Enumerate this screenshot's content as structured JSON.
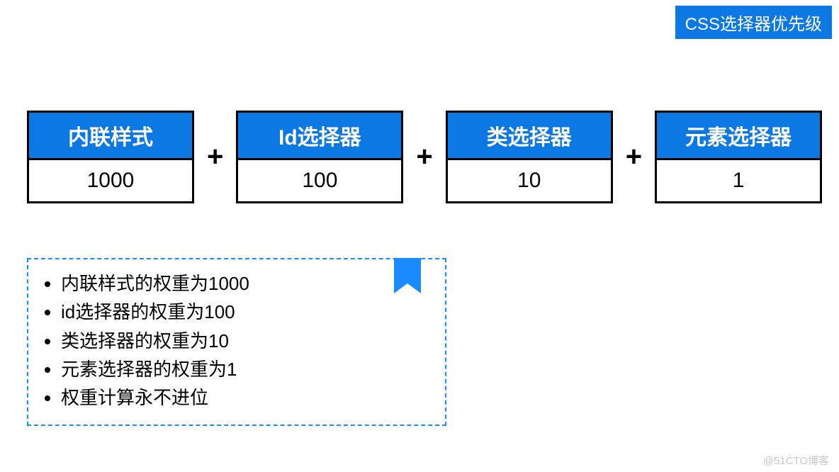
{
  "title": "CSS选择器优先级",
  "selectors": [
    {
      "label": "内联样式",
      "value": "1000"
    },
    {
      "label": "Id选择器",
      "value": "100"
    },
    {
      "label": "类选择器",
      "value": "10"
    },
    {
      "label": "元素选择器",
      "value": "1"
    }
  ],
  "plus": "+",
  "notes": [
    "内联样式的权重为1000",
    "id选择器的权重为100",
    "类选择器的权重为10",
    "元素选择器的权重为1",
    "权重计算永不进位"
  ],
  "watermark": "@51CTO博客",
  "colors": {
    "accent": "#0b78e3"
  }
}
